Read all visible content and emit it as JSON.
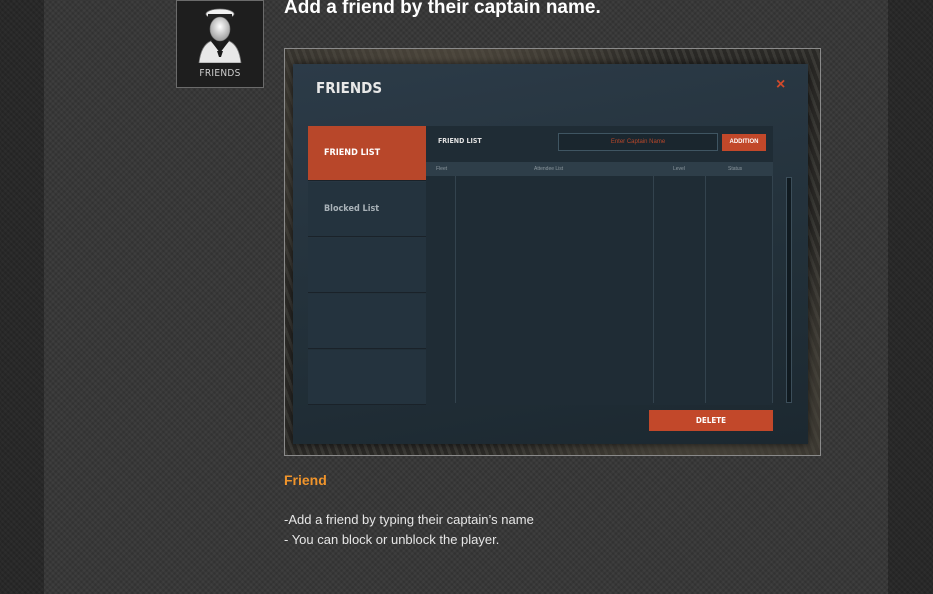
{
  "icon": {
    "name": "sailor-icon",
    "caption": "FRIENDS"
  },
  "headline": "Add a friend by their captain name.",
  "screenshot": {
    "title": "FRIENDS",
    "close_glyph": "×",
    "tabs": [
      {
        "label": "FRIEND LIST",
        "active": true
      },
      {
        "label": "Blocked List",
        "active": false
      }
    ],
    "panel_title": "FRIEND LIST",
    "search_placeholder": "Enter Captain Name",
    "add_button": "ADDITION",
    "columns": [
      "Fleet",
      "Attendee List",
      "Level",
      "Status"
    ],
    "delete_button": "DELETE",
    "colors": {
      "accent": "#c2482a",
      "window": "#223039"
    }
  },
  "section": {
    "title": "Friend",
    "lines": [
      " -Add a friend by typing their captain’s name",
      "- You can block or unblock the player."
    ]
  }
}
